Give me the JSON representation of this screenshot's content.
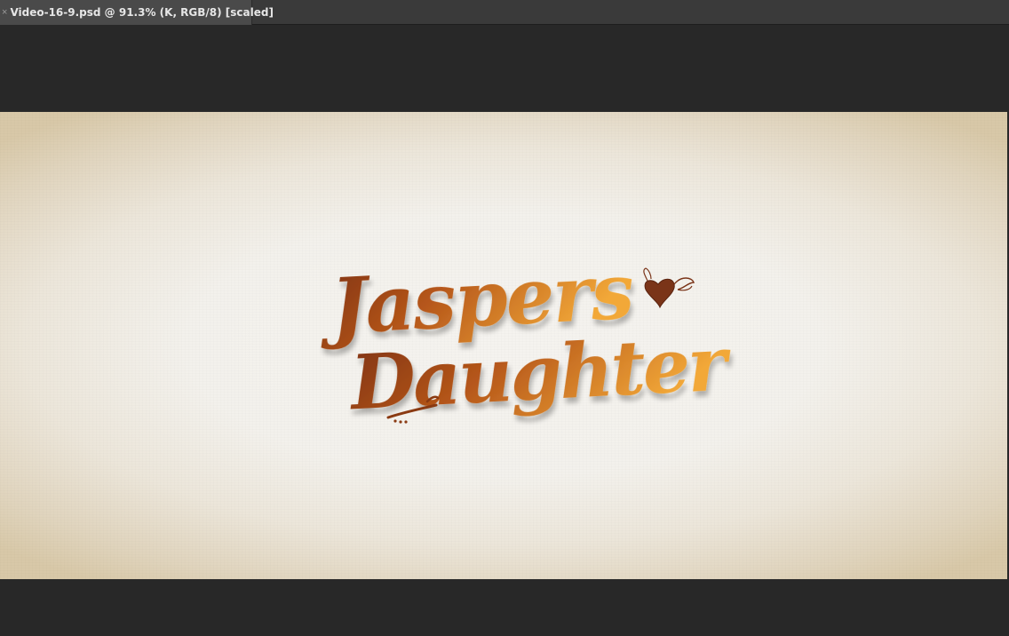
{
  "window": {
    "tab": {
      "title": "Video-16-9.psd @ 91.3% (K, RGB/8) [scaled]",
      "close_glyph": "×",
      "close_icon": "close-icon"
    }
  },
  "canvas": {
    "logo": {
      "line1": "Jaspers",
      "line2": "Daughter",
      "heart_icon": "winged-heart-icon",
      "flourish_icon": "splash-flourish-icon"
    },
    "colors": {
      "logo_dark": "#8a3a10",
      "logo_light": "#f0a030",
      "heart": "#7a3418",
      "paper_center": "#f5f3ef",
      "paper_edge": "#d8c8a8",
      "workspace_bg": "#282828"
    }
  }
}
